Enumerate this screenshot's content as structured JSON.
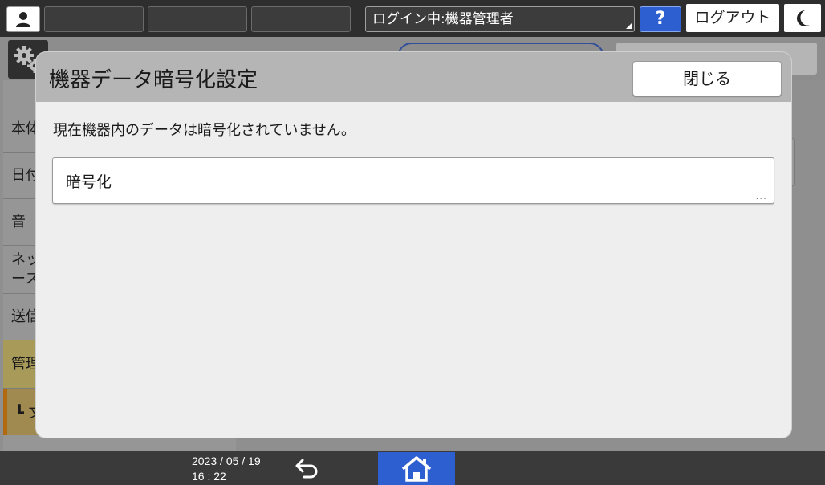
{
  "topbar": {
    "login_status": "ログイン中:機器管理者",
    "help_label": "?",
    "logout_label": "ログアウト"
  },
  "sidebar": {
    "items": [
      {
        "label": "本体"
      },
      {
        "label": "日付"
      },
      {
        "label": "音"
      },
      {
        "label": "ネッ",
        "label2": "ース"
      },
      {
        "label": "送信"
      },
      {
        "label": "管理"
      }
    ],
    "sub_item": "┗ 文"
  },
  "dialog": {
    "title": "機器データ暗号化設定",
    "close_label": "閉じる",
    "status_text": "現在機器内のデータは暗号化されていません。",
    "encrypt_label": "暗号化",
    "more_indicator": "..."
  },
  "footer": {
    "date": "2023 / 05 / 19",
    "time": "16 : 22"
  },
  "colors": {
    "accent": "#2d5fd0",
    "selected_item": "#a89b5a"
  }
}
